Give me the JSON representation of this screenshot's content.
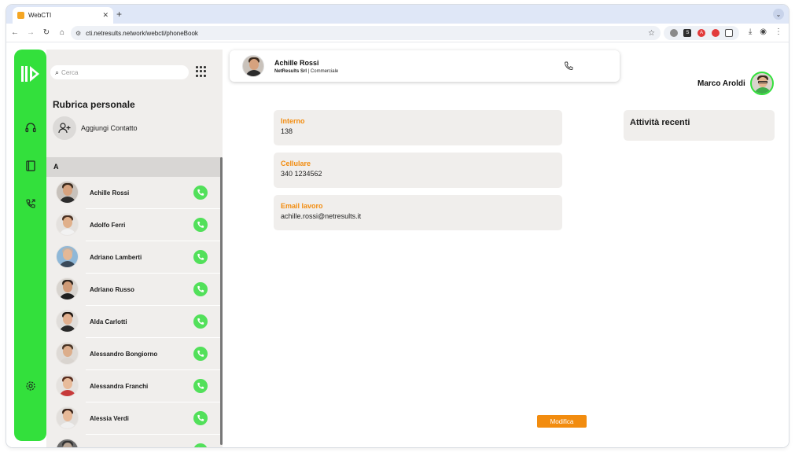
{
  "browser": {
    "tab_title": "WebCTI",
    "tab_close": "✕",
    "new_tab": "+",
    "url": "cti.netresults.network/webcti/phoneBook"
  },
  "sidebar": {
    "icons": [
      "headset-icon",
      "address-book-icon",
      "call-history-icon",
      "settings-icon"
    ]
  },
  "phonebook": {
    "search_placeholder": "Cerca",
    "title": "Rubrica personale",
    "add_contact": "Aggiungi Contatto",
    "letter": "A",
    "contacts": [
      {
        "name": "Achille Rossi",
        "skin": "#d6a27e",
        "hair": "#3b2a1d",
        "shirt": "#2c2c2c",
        "bg": "#c7c1bb"
      },
      {
        "name": "Adolfo Ferri",
        "skin": "#e0b08b",
        "hair": "#4a3122",
        "shirt": "#f2f2f2",
        "bg": "#e4e1de"
      },
      {
        "name": "Adriano Lamberti",
        "skin": "#e4b896",
        "hair": "#b9b3ad",
        "shirt": "#3a4a5a",
        "bg": "#8fb8d8"
      },
      {
        "name": "Adriano Russo",
        "skin": "#cf9a76",
        "hair": "#2c221b",
        "shirt": "#1f1f1f",
        "bg": "#d8d4cf"
      },
      {
        "name": "Alda Carlotti",
        "skin": "#e2b08f",
        "hair": "#1e1611",
        "shirt": "#2a2a2a",
        "bg": "#e0ddda"
      },
      {
        "name": "Alessandro Bongiorno",
        "skin": "#dcae8c",
        "hair": "#4a3526",
        "shirt": "#d9d4cf",
        "bg": "#dedad6"
      },
      {
        "name": "Alessandra Franchi",
        "skin": "#e8bb9a",
        "hair": "#5a2e1f",
        "shirt": "#c73a3a",
        "bg": "#e5e2df"
      },
      {
        "name": "Alessia Verdi",
        "skin": "#e7b998",
        "hair": "#3b2419",
        "shirt": "#f0f0f0",
        "bg": "#e2dfdc"
      },
      {
        "name": "",
        "skin": "#b8a595",
        "hair": "#333333",
        "shirt": "#444444",
        "bg": "#6b6b6b"
      }
    ]
  },
  "contact_card": {
    "name": "Achille Rossi",
    "company": "NetResults Srl",
    "separator": " | ",
    "role": "Commerciale"
  },
  "user": {
    "name": "Marco Aroldi"
  },
  "details": {
    "fields": [
      {
        "label": "Interno",
        "value": "138"
      },
      {
        "label": "Cellulare",
        "value": "340 1234562"
      },
      {
        "label": "Email lavoro",
        "value": "achille.rossi@netresults.it"
      }
    ],
    "recent_title": "Attività recenti",
    "edit_button": "Modifica"
  },
  "colors": {
    "brand_green": "#33e03c",
    "call_green": "#52e05a",
    "accent_orange": "#f28c0f",
    "panel_bg": "#f0eeec"
  }
}
